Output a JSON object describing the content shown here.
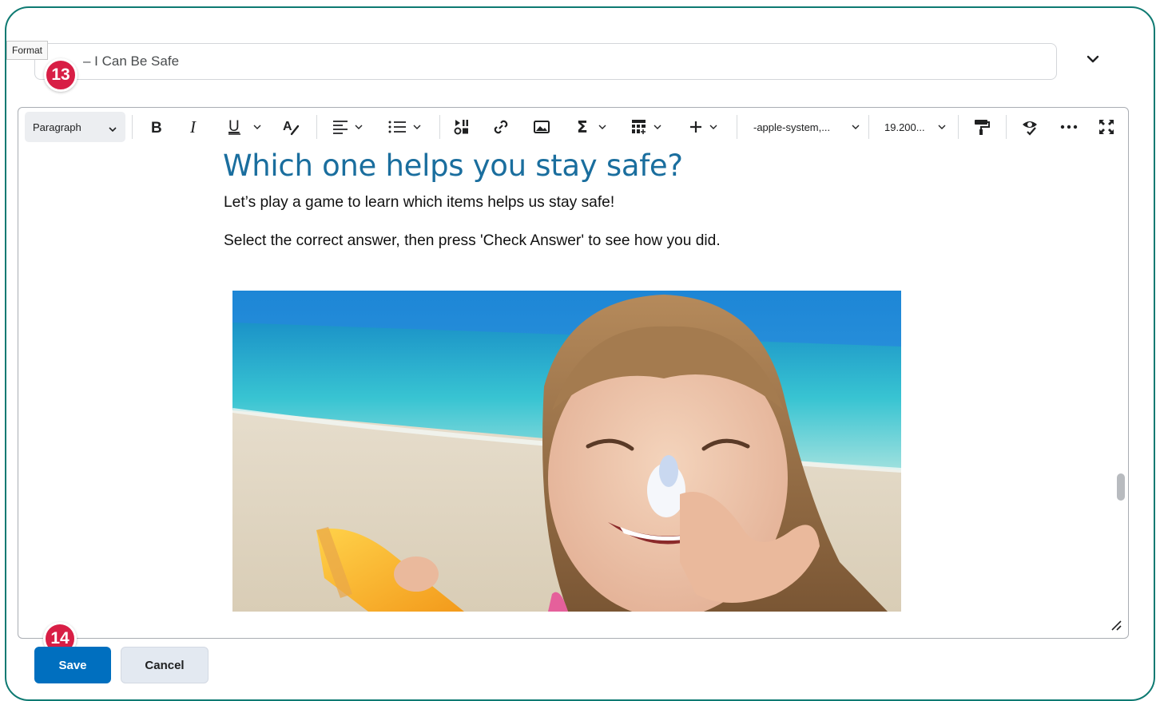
{
  "tooltip": "Format",
  "title_field": {
    "value": "– I Can Be Safe"
  },
  "badges": {
    "step_a": "13",
    "step_b": "14"
  },
  "toolbar": {
    "format_select": "Paragraph",
    "font_family": "-apple-system,...",
    "font_size": "19.200..."
  },
  "content": {
    "heading": "Which one helps you stay safe?",
    "para1": "Let’s play a game to learn which items helps us stay safe!",
    "para2": "Select the correct answer, then press 'Check Answer' to see how you did."
  },
  "buttons": {
    "save": "Save",
    "cancel": "Cancel"
  },
  "colors": {
    "frame": "#0e7a72",
    "heading": "#1a6e9e",
    "primary": "#006fbf",
    "badge": "#d81e45"
  }
}
